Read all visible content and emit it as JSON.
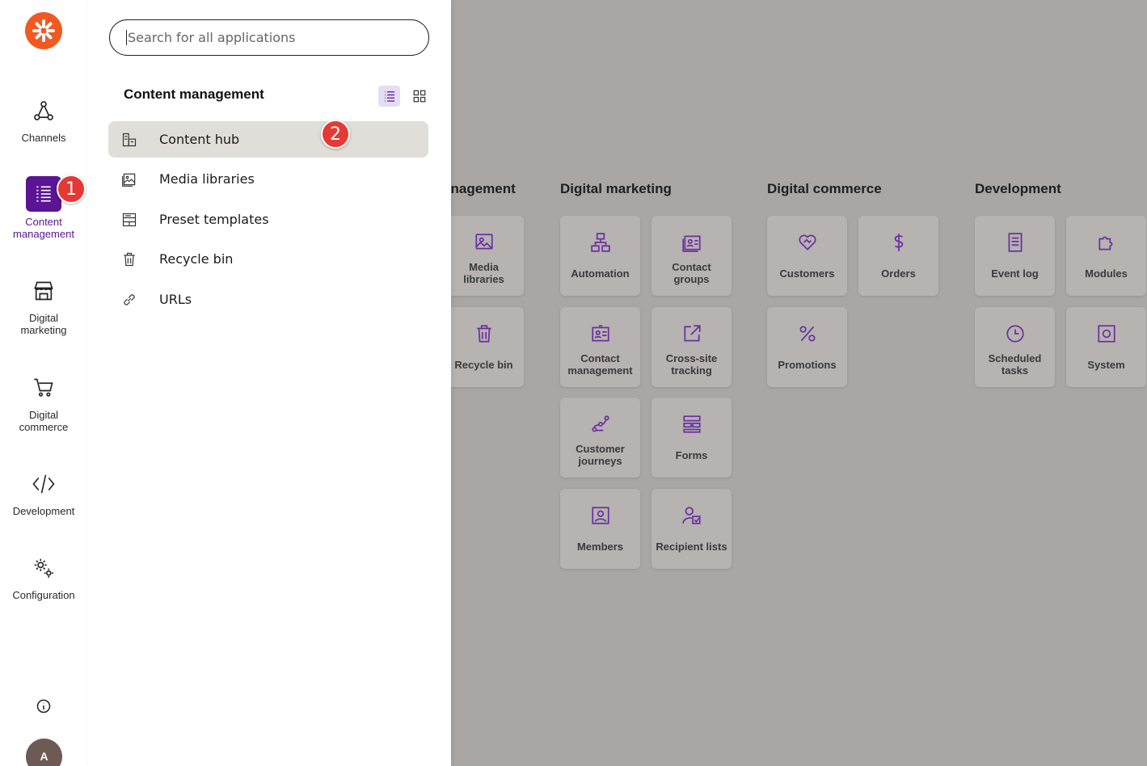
{
  "rail": {
    "items": [
      {
        "label": "Channels",
        "icon": "channels-icon"
      },
      {
        "label": "Content\nmanagement",
        "icon": "content-management-icon",
        "active": true
      },
      {
        "label": "Digital\nmarketing",
        "icon": "digital-marketing-icon"
      },
      {
        "label": "Digital\ncommerce",
        "icon": "cart-icon"
      },
      {
        "label": "Development",
        "icon": "code-icon"
      },
      {
        "label": "Configuration",
        "icon": "gears-icon"
      }
    ],
    "avatar": "A",
    "badge1": "1"
  },
  "flyout": {
    "search_placeholder": "Search for all applications",
    "title": "Content management",
    "badge2": "2",
    "items": [
      {
        "label": "Content hub",
        "icon": "content-hub-icon",
        "active": true
      },
      {
        "label": "Media libraries",
        "icon": "media-library-icon"
      },
      {
        "label": "Preset templates",
        "icon": "preset-templates-icon"
      },
      {
        "label": "Recycle bin",
        "icon": "trash-icon"
      },
      {
        "label": "URLs",
        "icon": "link-icon"
      }
    ]
  },
  "dashboard": {
    "categories": {
      "content": "Content management",
      "marketing": "Digital marketing",
      "commerce": "Digital commerce",
      "development": "Development"
    },
    "tiles": {
      "media_libraries": "Media libraries",
      "recycle_bin": "Recycle bin",
      "automation": "Automation",
      "contact_groups": "Contact groups",
      "contact_management": "Contact management",
      "cross_site_tracking": "Cross-site tracking",
      "customer_journeys": "Customer journeys",
      "forms": "Forms",
      "members": "Members",
      "recipient_lists": "Recipient lists",
      "customers": "Customers",
      "orders": "Orders",
      "promotions": "Promotions",
      "event_log": "Event log",
      "modules": "Modules",
      "scheduled_tasks": "Scheduled tasks",
      "system": "System"
    }
  },
  "colors": {
    "accent": "#5a1494",
    "logo": "#f05a22",
    "badge": "#e53935",
    "tile_icon": "#6b2fa0"
  }
}
